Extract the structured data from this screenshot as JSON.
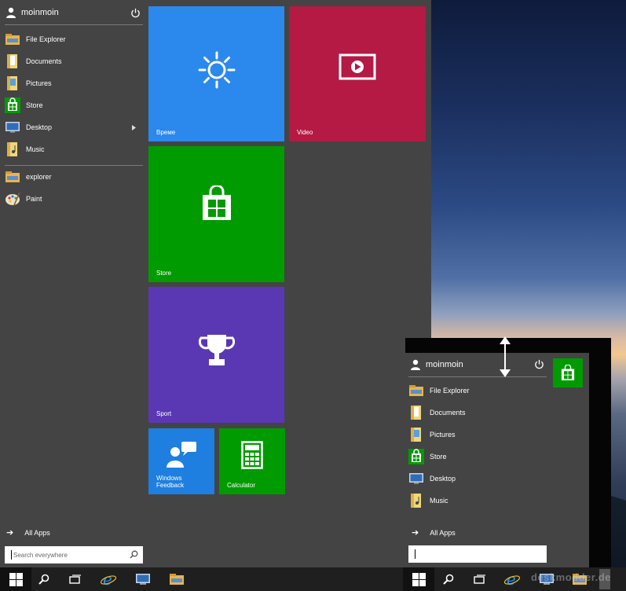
{
  "start_menu": {
    "user_name": "moinmoin",
    "apps": [
      {
        "label": "File Explorer",
        "icon": "file-explorer-icon"
      },
      {
        "label": "Documents",
        "icon": "documents-folder-icon"
      },
      {
        "label": "Pictures",
        "icon": "pictures-folder-icon"
      },
      {
        "label": "Store",
        "icon": "store-icon"
      },
      {
        "label": "Desktop",
        "icon": "desktop-icon"
      },
      {
        "label": "Music",
        "icon": "music-folder-icon"
      }
    ],
    "pinned": [
      {
        "label": "explorer",
        "icon": "explorer-icon"
      },
      {
        "label": "Paint",
        "icon": "paint-icon"
      }
    ],
    "all_apps_label": "All Apps",
    "search_placeholder": "Search everywhere"
  },
  "tiles": [
    {
      "label": "Време",
      "color": "#2b88ec",
      "icon": "sun-icon"
    },
    {
      "label": "Video",
      "color": "#b41a44",
      "icon": "video-icon"
    },
    {
      "label": "Store",
      "color": "#009b00",
      "icon": "store-bag-icon"
    },
    {
      "label": "Sport",
      "color": "#5a38b4",
      "icon": "trophy-icon"
    },
    {
      "label": "Windows Feedback",
      "line1": "Windows",
      "line2": "Feedback",
      "color": "#1e7fe0",
      "icon": "feedback-icon"
    },
    {
      "label": "Calculator",
      "color": "#009b00",
      "icon": "calculator-icon"
    }
  ],
  "small_menu": {
    "user_name": "moinmoin",
    "apps": [
      {
        "label": "File Explorer"
      },
      {
        "label": "Documents"
      },
      {
        "label": "Pictures"
      },
      {
        "label": "Store"
      },
      {
        "label": "Desktop"
      },
      {
        "label": "Music"
      }
    ],
    "all_apps_label": "All Apps"
  },
  "watermark": "deskmodder.de",
  "colors": {
    "menu_bg": "#444444",
    "taskbar_bg": "#1f1f1f",
    "store_green": "#009b00"
  }
}
